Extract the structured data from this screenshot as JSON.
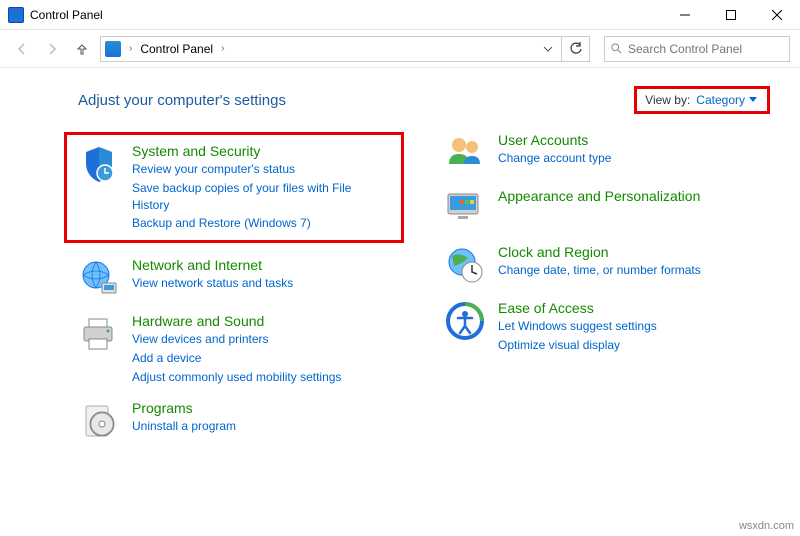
{
  "window": {
    "title": "Control Panel"
  },
  "address": {
    "crumb": "Control Panel"
  },
  "search": {
    "placeholder": "Search Control Panel"
  },
  "header": {
    "title": "Adjust your computer's settings"
  },
  "viewby": {
    "label": "View by:",
    "value": "Category"
  },
  "left": [
    {
      "title": "System and Security",
      "links": [
        "Review your computer's status",
        "Save backup copies of your files with File History",
        "Backup and Restore (Windows 7)"
      ]
    },
    {
      "title": "Network and Internet",
      "links": [
        "View network status and tasks"
      ]
    },
    {
      "title": "Hardware and Sound",
      "links": [
        "View devices and printers",
        "Add a device",
        "Adjust commonly used mobility settings"
      ]
    },
    {
      "title": "Programs",
      "links": [
        "Uninstall a program"
      ]
    }
  ],
  "right": [
    {
      "title": "User Accounts",
      "links": [
        "Change account type"
      ]
    },
    {
      "title": "Appearance and Personalization",
      "links": []
    },
    {
      "title": "Clock and Region",
      "links": [
        "Change date, time, or number formats"
      ]
    },
    {
      "title": "Ease of Access",
      "links": [
        "Let Windows suggest settings",
        "Optimize visual display"
      ]
    }
  ],
  "watermark": "wsxdn.com"
}
